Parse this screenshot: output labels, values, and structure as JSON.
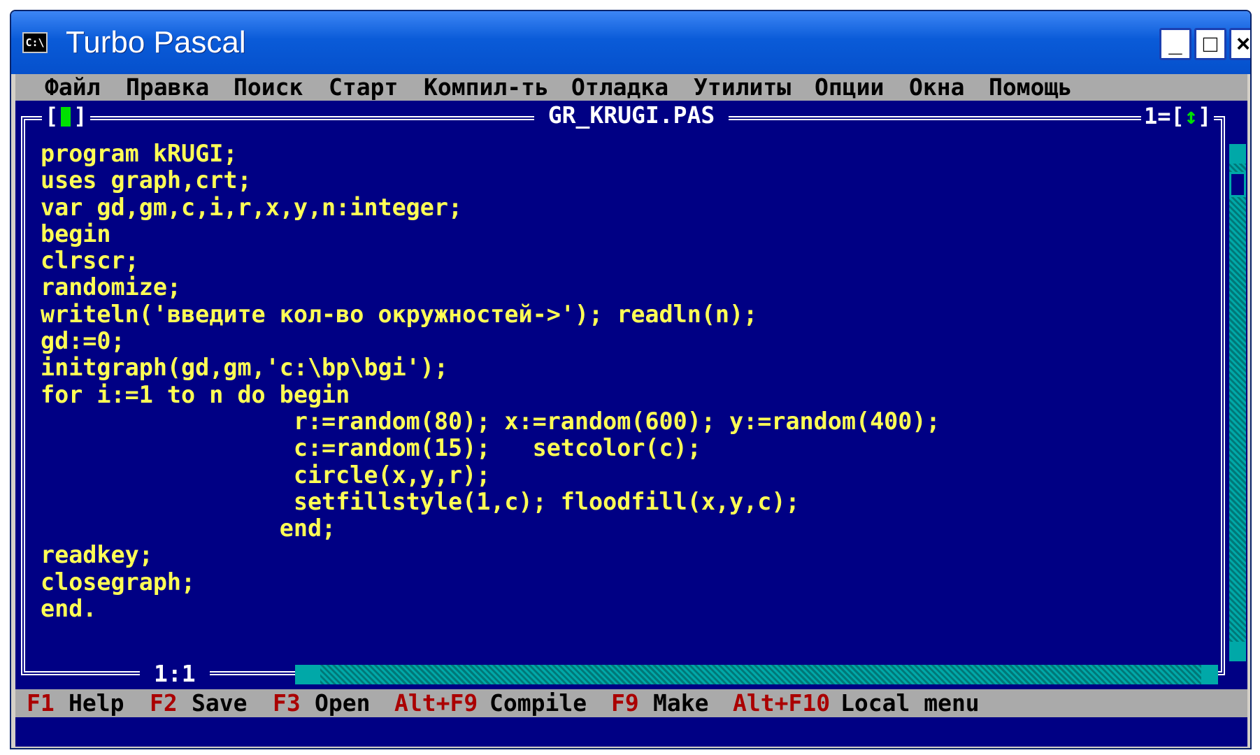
{
  "window": {
    "title": "Turbo Pascal",
    "icon_label": "C:\\",
    "minimize_label": "_",
    "maximize_label": "□",
    "close_label": "×"
  },
  "menu": [
    "Файл",
    "Правка",
    "Поиск",
    "Старт",
    "Компил-ть",
    "Отладка",
    "Утилиты",
    "Опции",
    "Окна",
    "Помощь"
  ],
  "editor": {
    "filename": "GR_KRUGI.PAS",
    "close_box": "[",
    "close_box_end": "]",
    "window_number": "1=[",
    "resize_glyph": "↕",
    "window_number_end": "]",
    "cursor_position": "1:1",
    "code": "program kRUGI;\nuses graph,crt;\nvar gd,gm,c,i,r,x,y,n:integer;\nbegin\nclrscr;\nrandomize;\nwriteln('введите кол-во окружностей->'); readln(n);\ngd:=0;\ninitgraph(gd,gm,'c:\\bp\\bgi');\nfor i:=1 to n do begin\n                  r:=random(80); x:=random(600); y:=random(400);\n                  c:=random(15);   setcolor(c);\n                  circle(x,y,r);\n                  setfillstyle(1,c); floodfill(x,y,c);\n                 end;\nreadkey;\nclosegraph;\nend."
  },
  "status": {
    "f1_key": "F1",
    "f1_label": "Help",
    "f2_key": "F2",
    "f2_label": "Save",
    "f3_key": "F3",
    "f3_label": "Open",
    "altf9_key": "Alt+F9",
    "altf9_label": "Compile",
    "f9_key": "F9",
    "f9_label": "Make",
    "altf10_key": "Alt+F10",
    "altf10_label": "Local menu"
  },
  "colors": {
    "editor_bg": "#000084",
    "code_text": "#ffff55",
    "menu_bg": "#aaaaaa",
    "hotkey": "#aa0000",
    "scrollbar": "#00a8a8"
  }
}
